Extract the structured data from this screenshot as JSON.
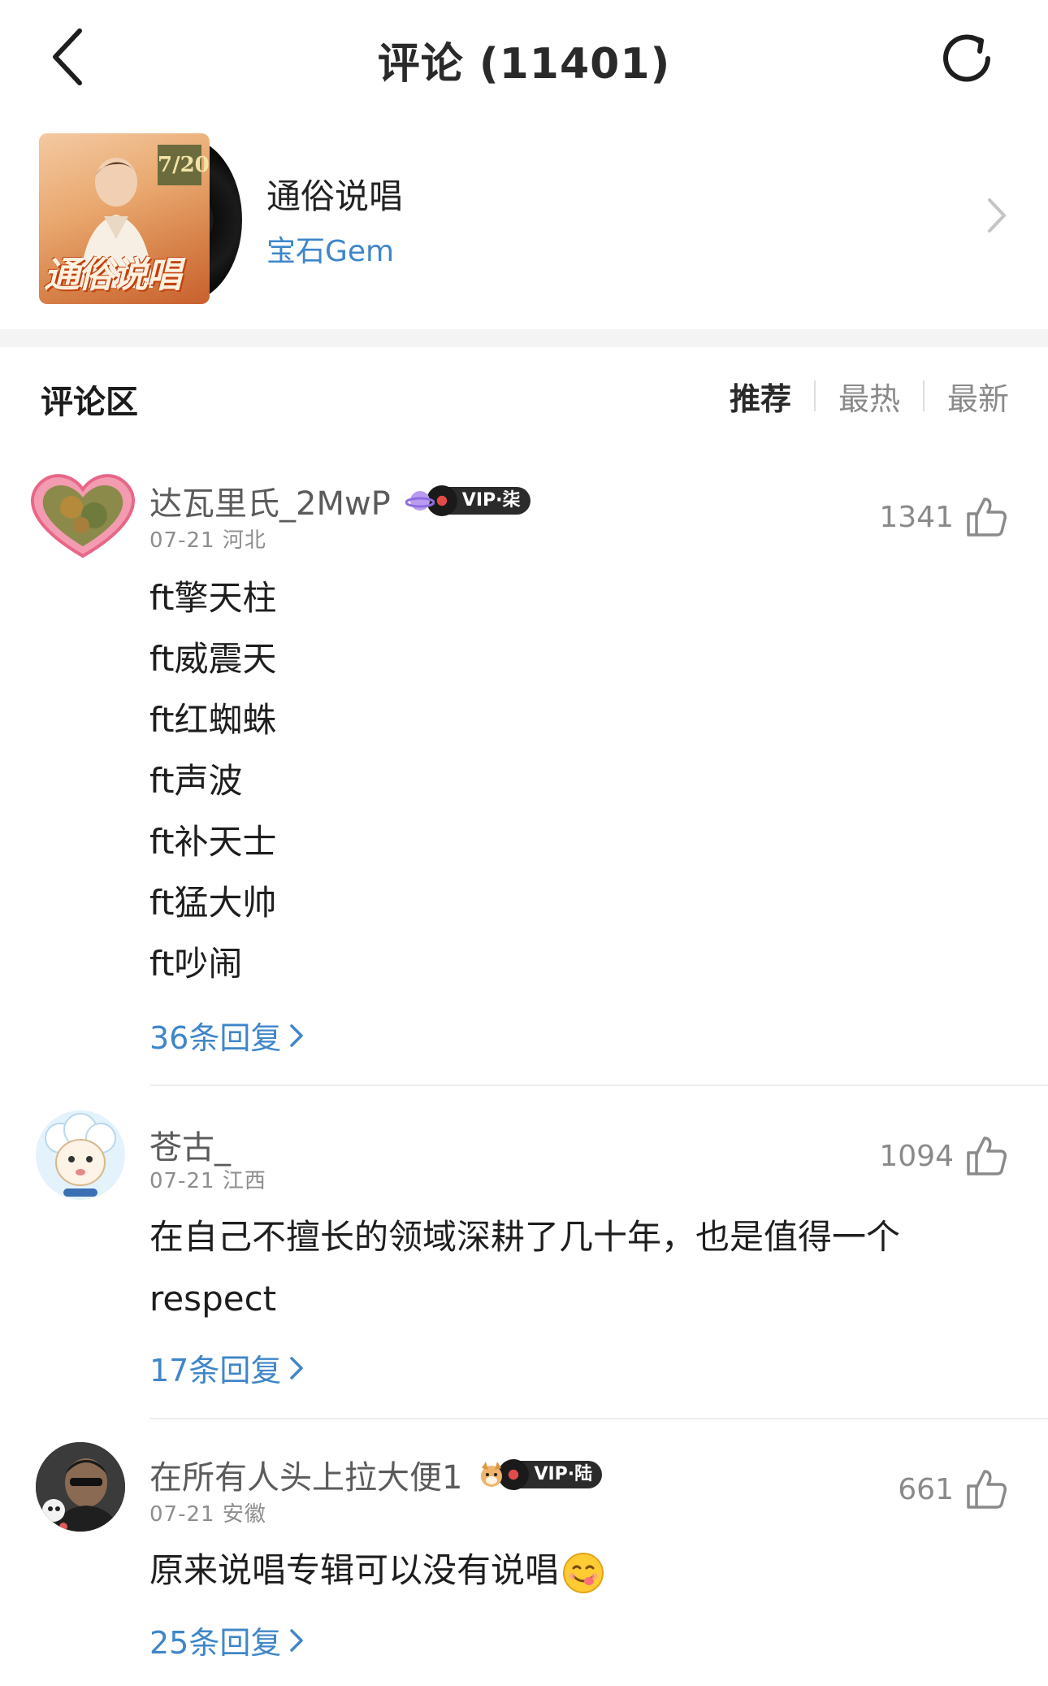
{
  "header": {
    "title": "评论 (11401)"
  },
  "song": {
    "name": "通俗说唱",
    "artist": "宝石Gem",
    "cover_date_text": "7/20",
    "cover_title_text": "通俗说唱"
  },
  "comment_section": {
    "title": "评论区",
    "sort_tabs": [
      "推荐",
      "最热",
      "最新"
    ],
    "active_tab": "推荐"
  },
  "comments": [
    {
      "username": "达瓦里氏_2MwP",
      "vip_label": "VIP·柒",
      "date": "07-21",
      "location": "河北",
      "likes": "1341",
      "lines": [
        "ft擎天柱",
        "ft威震天",
        "ft红蜘蛛",
        "ft声波",
        "ft补天士",
        "ft猛大帅",
        "ft吵闹"
      ],
      "replies": "36条回复"
    },
    {
      "username": "苍古_",
      "date": "07-21",
      "location": "江西",
      "likes": "1094",
      "text": "在自己不擅长的领域深耕了几十年，也是值得一个 respect",
      "replies": "17条回复"
    },
    {
      "username": "在所有人头上拉大便1",
      "vip_label": "VIP·陆",
      "date": "07-21",
      "location": "安徽",
      "likes": "661",
      "text": "原来说唱专辑可以没有说唱",
      "emoji": "smiling-tongue-emoji",
      "replies": "25条回复"
    }
  ],
  "colors": {
    "link": "#3f86c9",
    "muted": "#8a8a8a",
    "vip_bg": "#2b2b2b",
    "divider": "#f4f4f4"
  }
}
